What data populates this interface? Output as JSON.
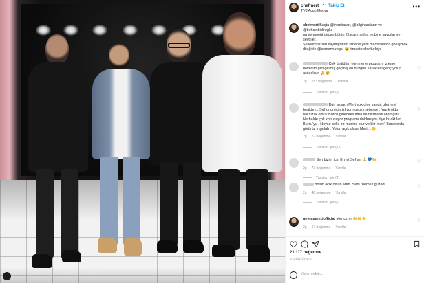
{
  "header": {
    "username": "chefmert",
    "separator": "•",
    "follow_label": "Takip Et",
    "subtitle": "TV8 Acun Medya",
    "more_icon": "more-horizontal-icon"
  },
  "caption": {
    "username": "chefmert",
    "lines": [
      "Başta @iremkaran, @bilginarslann ve @behcethidiroglu",
      "na ve emeği geçen bütün @acunmedya ekibine saygılar ve sevgiler.",
      "Şeflerim sizleri saymıyorum sizlerle yeni maceralarda görüşmek",
      "dileğiyle @somervuroglu 😉 #masterchefturkiye"
    ]
  },
  "comments": [
    {
      "lines": [
        "Çok üzüldüm elenmene programı izleme",
        "hevesim gitti gelmiş geçmiş en düzgün karakterli genç yolun",
        "açık olsun 🙏😊"
      ],
      "time": "2g",
      "likes": "153 beğenme",
      "reply": "Yanıtla",
      "view_replies": "Yanıtları gör (3)"
    },
    {
      "lines": [
        "Dün akşam Mert yok diye yanda izlemeyi",
        "bıraktım . Sırf onun için izliyormuşuz meğerse . Yazık oldu",
        "haksızlık oldu ! Burcu gidecekti ama ne hikmetse Mert gitti .",
        "Herhalde çok konuşuyor programı dolduruyor diye bıraktılar",
        "Burcu'yu . Neyse belki bir mucize olur ve biz Mert'i Survivorda",
        "görürüz inşallah . Yolun açık olsun Mert ...👏"
      ],
      "time": "2g",
      "likes": "72 beğenme",
      "reply": "Yanıtla",
      "view_replies": "Yanıtları gör (15)"
    },
    {
      "lines": [
        "Sen bizim için En iyi Şef sin 🙏💙👏"
      ],
      "time": "2g",
      "likes": "73 beğenme",
      "reply": "Yanıtla",
      "view_replies": "Yanıtları gör (2)"
    },
    {
      "lines": [
        "Yolun açık olsun Mert. Seni izlemek güzedi"
      ],
      "time": "2g",
      "likes": "48 beğenme",
      "reply": "Yanıtla",
      "view_replies": "Yanıtları gör (1)"
    },
    {
      "username": "nevrasereziofficial",
      "lines": [
        "Mertcimm👏👏👏"
      ],
      "time": "2g",
      "likes": "67 beğenme",
      "reply": "Yanıtla",
      "view_replies": ""
    }
  ],
  "actions": {
    "likes": "21.117 beğenme",
    "date": "3 GÜN ÖNCE"
  },
  "add_comment": {
    "placeholder": "Yorum ekle..."
  },
  "photo": {
    "overflow_icon": "ellipsis-icon",
    "overflow_glyph": "…",
    "accent_colors": {
      "wall_pink": "#e6b3ba",
      "backdrop": "#141112",
      "floor": "#f2f2f2"
    }
  },
  "colors": {
    "link": "#00376b",
    "follow": "#0095f6",
    "muted": "#8e8e8e"
  }
}
